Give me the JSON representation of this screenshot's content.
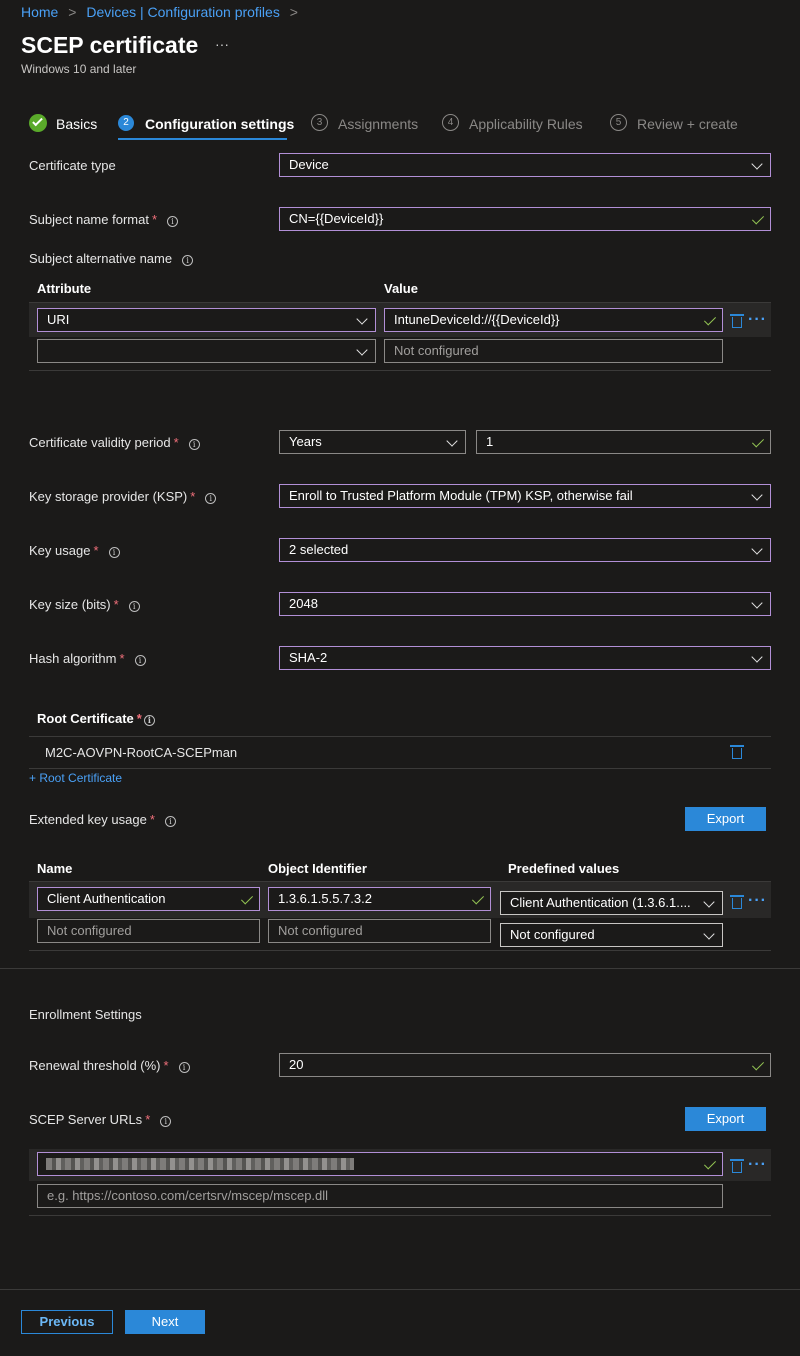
{
  "breadcrumb": {
    "home": "Home",
    "devices": "Devices | Configuration profiles",
    "sep": ">"
  },
  "page": {
    "title": "SCEP certificate",
    "more": "···",
    "subtitle": "Windows 10 and later"
  },
  "wizard": {
    "steps": [
      {
        "num": "",
        "label": "Basics",
        "state": "complete"
      },
      {
        "num": "2",
        "label": "Configuration settings",
        "state": "active"
      },
      {
        "num": "3",
        "label": "Assignments",
        "state": "pending"
      },
      {
        "num": "4",
        "label": "Applicability Rules",
        "state": "pending"
      },
      {
        "num": "5",
        "label": "Review + create",
        "state": "pending"
      }
    ]
  },
  "form": {
    "certificate_type": {
      "label": "Certificate type",
      "value": "Device"
    },
    "subject_name_format": {
      "label": "Subject name format",
      "value": "CN={{DeviceId}}"
    },
    "san": {
      "label": "Subject alternative name",
      "col_attribute": "Attribute",
      "col_value": "Value",
      "rows": [
        {
          "attribute": "URI",
          "value": "IntuneDeviceId://{{DeviceId}}"
        }
      ],
      "empty_value_placeholder": "Not configured"
    },
    "validity": {
      "label": "Certificate validity period",
      "unit": "Years",
      "value": "1"
    },
    "ksp": {
      "label": "Key storage provider (KSP)",
      "value": "Enroll to Trusted Platform Module (TPM) KSP, otherwise fail"
    },
    "key_usage": {
      "label": "Key usage",
      "value": "2 selected"
    },
    "key_size": {
      "label": "Key size (bits)",
      "value": "2048"
    },
    "hash_algorithm": {
      "label": "Hash algorithm",
      "value": "SHA-2"
    },
    "root_cert": {
      "label": "Root Certificate",
      "value": "M2C-AOVPN-RootCA-SCEPman",
      "add_link": "+ Root Certificate"
    },
    "eku": {
      "label": "Extended key usage",
      "export": "Export",
      "col_name": "Name",
      "col_oid": "Object Identifier",
      "col_predefined": "Predefined values",
      "rows": [
        {
          "name": "Client Authentication",
          "oid": "1.3.6.1.5.5.7.3.2",
          "predefined": "Client Authentication (1.3.6.1...."
        }
      ],
      "empty_name": "Not configured",
      "empty_oid": "Not configured",
      "empty_predefined": "Not configured"
    }
  },
  "enrollment": {
    "heading": "Enrollment Settings",
    "renewal": {
      "label": "Renewal threshold (%)",
      "value": "20"
    },
    "scep_urls": {
      "label": "SCEP Server URLs",
      "export": "Export",
      "placeholder": "e.g. https://contoso.com/certsrv/mscep/mscep.dll"
    }
  },
  "footer": {
    "previous": "Previous",
    "next": "Next"
  },
  "colors": {
    "accent": "#2b88d8",
    "field_border": "#b28fd6",
    "success": "#92c353",
    "required": "#f1707b"
  }
}
